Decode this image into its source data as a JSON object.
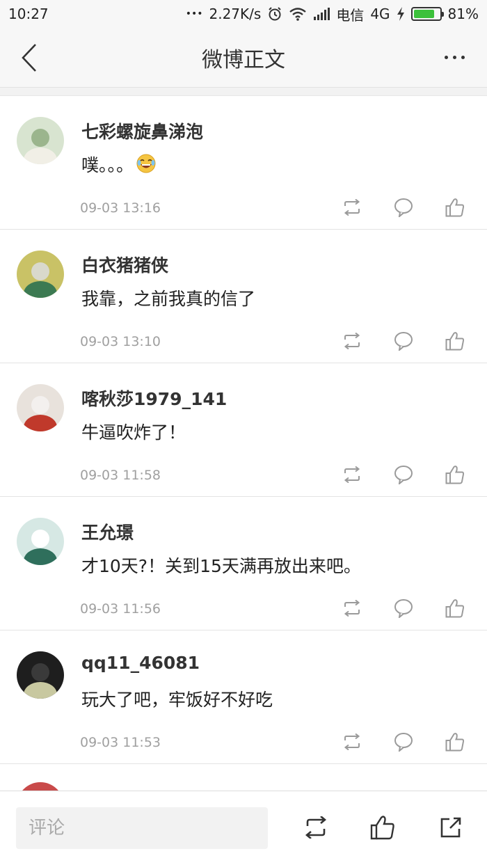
{
  "status_bar": {
    "time": "10:27",
    "dots": "•••",
    "speed": "2.27K/s",
    "carrier": "电信",
    "network": "4G",
    "battery": "81%",
    "battery_level": 0.81,
    "icons": [
      "alarm-icon",
      "wifi-icon",
      "signal-icon",
      "charging-icon",
      "battery-icon"
    ]
  },
  "nav": {
    "title": "微博正文",
    "back_icon": "chevron-left-icon",
    "more_icon": "more-dots-icon"
  },
  "comments": [
    {
      "name": "七彩螺旋鼻涕泡",
      "text": "噗。。。",
      "emoji": "laughing-tears-emoji",
      "time": "09-03 13:16",
      "avatar_colors": [
        "#d8e4d0",
        "#f1efe6",
        "#9bb58d"
      ]
    },
    {
      "name": "白衣猪猪侠",
      "text": "我靠，之前我真的信了",
      "time": "09-03 13:10",
      "avatar_colors": [
        "#c9c266",
        "#3c7a52",
        "#d9d9cc"
      ]
    },
    {
      "name": "喀秋莎1979_141",
      "text": "牛逼吹炸了！",
      "time": "09-03 11:58",
      "avatar_colors": [
        "#e8e2dc",
        "#c0392b",
        "#f3f0ee"
      ]
    },
    {
      "name": "王允璟",
      "text": "才10天?！关到15天满再放出来吧。",
      "time": "09-03 11:56",
      "avatar_colors": [
        "#d6e8e4",
        "#2f6f5c",
        "#ffffff"
      ]
    },
    {
      "name": "qq11_46081",
      "text": "玩大了吧，牢饭好不好吃",
      "time": "09-03 11:53",
      "avatar_colors": [
        "#1e1e1e",
        "#c8c8a0",
        "#3a3a3a"
      ]
    }
  ],
  "action_icons": [
    "repost-icon",
    "comment-icon",
    "like-icon"
  ],
  "bottom_bar": {
    "comment_placeholder": "评论",
    "icons": [
      "repost-icon",
      "like-icon",
      "share-icon"
    ]
  }
}
